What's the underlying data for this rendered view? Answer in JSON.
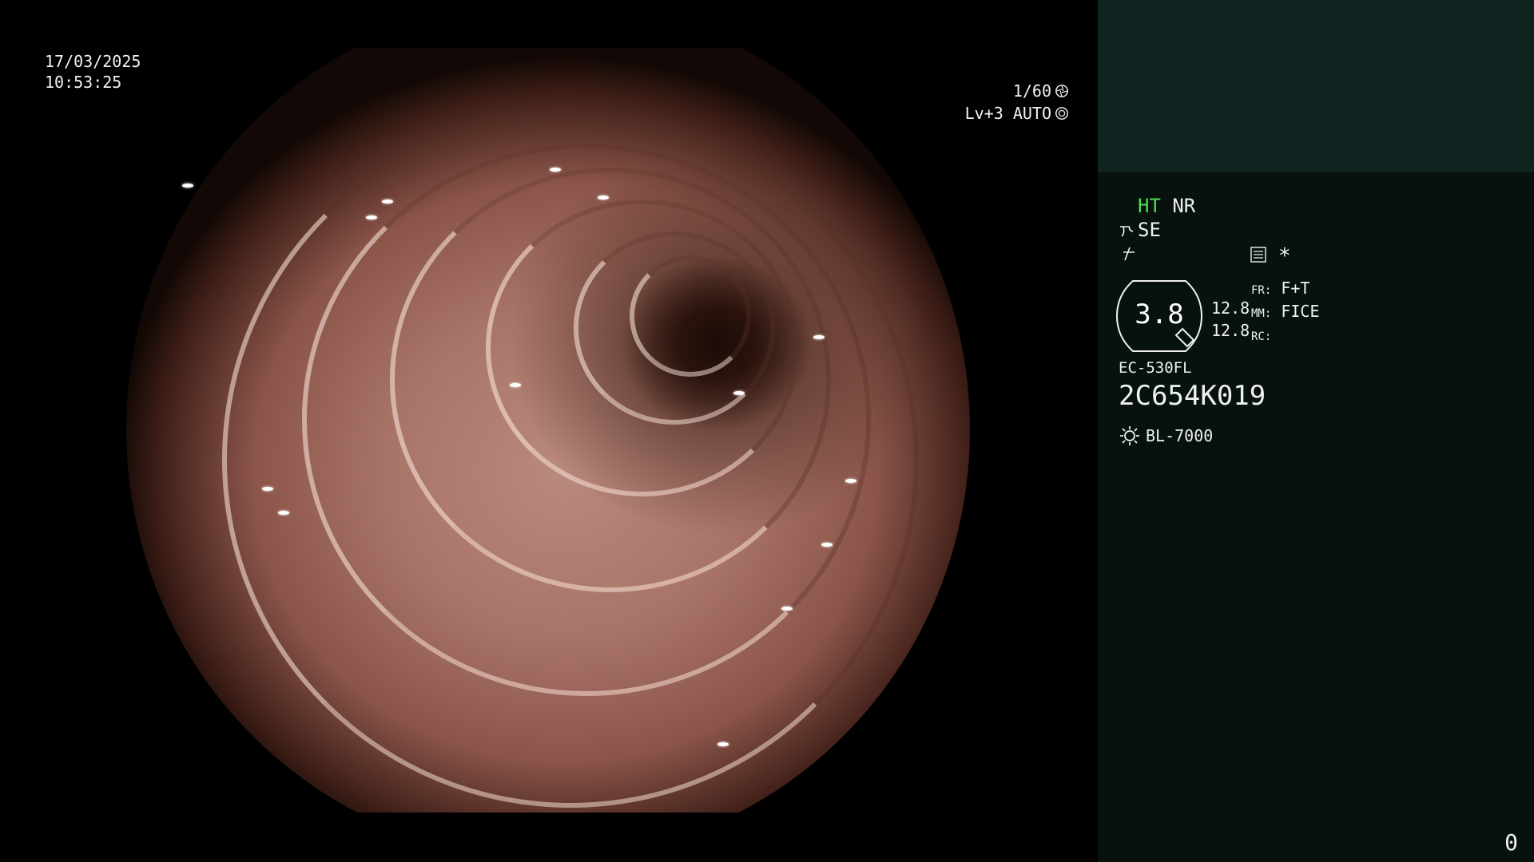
{
  "overlay": {
    "date": "17/03/2025",
    "time": "10:53:25",
    "shutter": "1/60",
    "shutter_icon": "shutter-icon",
    "level": "Lv+3 AUTO",
    "level_icon": "iris-icon"
  },
  "panel": {
    "ht": "HT",
    "nr": "NR",
    "se": "SE",
    "asterisk": "*",
    "gauge_value": "3.8",
    "row1_value": "12.8",
    "row2_value": "12.8",
    "fr_label": "FR:",
    "fr_value": "F+T",
    "mm_label": "MM:",
    "mm_value": "FICE",
    "rc_label": "RC:",
    "scope_model": "EC-530FL",
    "scope_serial": "2C654K019",
    "light_source": "BL-7000",
    "counter": "0"
  },
  "colors": {
    "ht_green": "#4bdc4b",
    "panel_bg": "#07120f",
    "panel_top_bg": "#0f2420"
  }
}
